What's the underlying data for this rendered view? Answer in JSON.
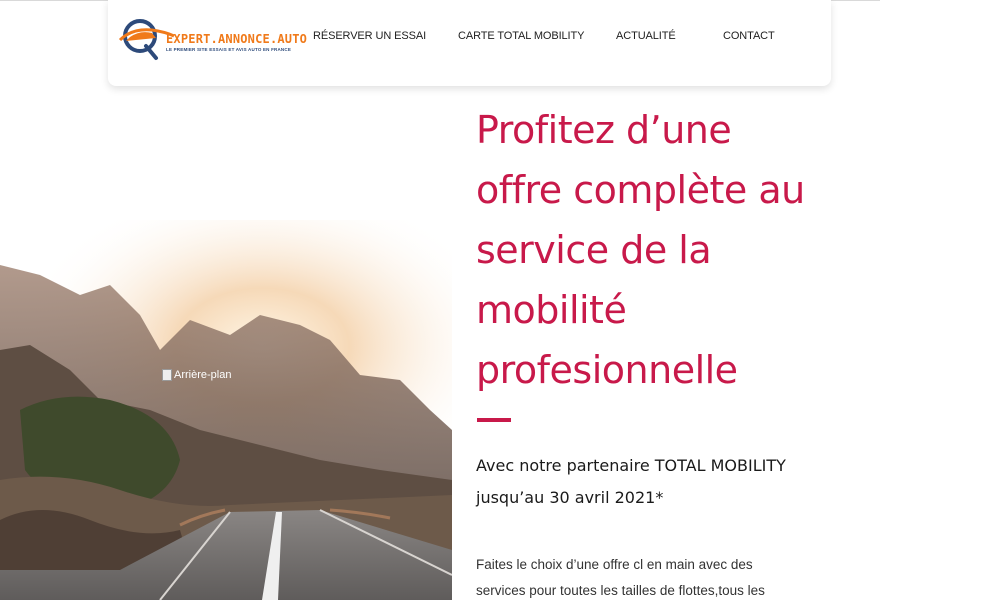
{
  "header": {
    "logo": {
      "name": "EXPERT.ANNONCE.AUTO",
      "tagline": "LE PREMIER SITE ESSAIS ET AVIS AUTO EN FRANCE",
      "colors": {
        "orange": "#f07a1a",
        "navy": "#2d4a7a"
      }
    },
    "nav": [
      {
        "label": "Réserver un essai"
      },
      {
        "label": "Carte TOTAL MOBILITY"
      },
      {
        "label": "Actualité"
      },
      {
        "label": "Contact"
      }
    ]
  },
  "hero": {
    "image_alt": "Arrière-plan",
    "headline": "Profitez d’une offre complète au service de la mobilité profesionnelle",
    "subline": "Avec notre partenaire TOTAL MOBILITY jusqu’au 30 avril 2021*",
    "body": "Faites le choix d’une offre cl en main avec des services pour toutes les tailles de flottes,tous les types de véhicule",
    "accent_color": "#c8194a"
  }
}
